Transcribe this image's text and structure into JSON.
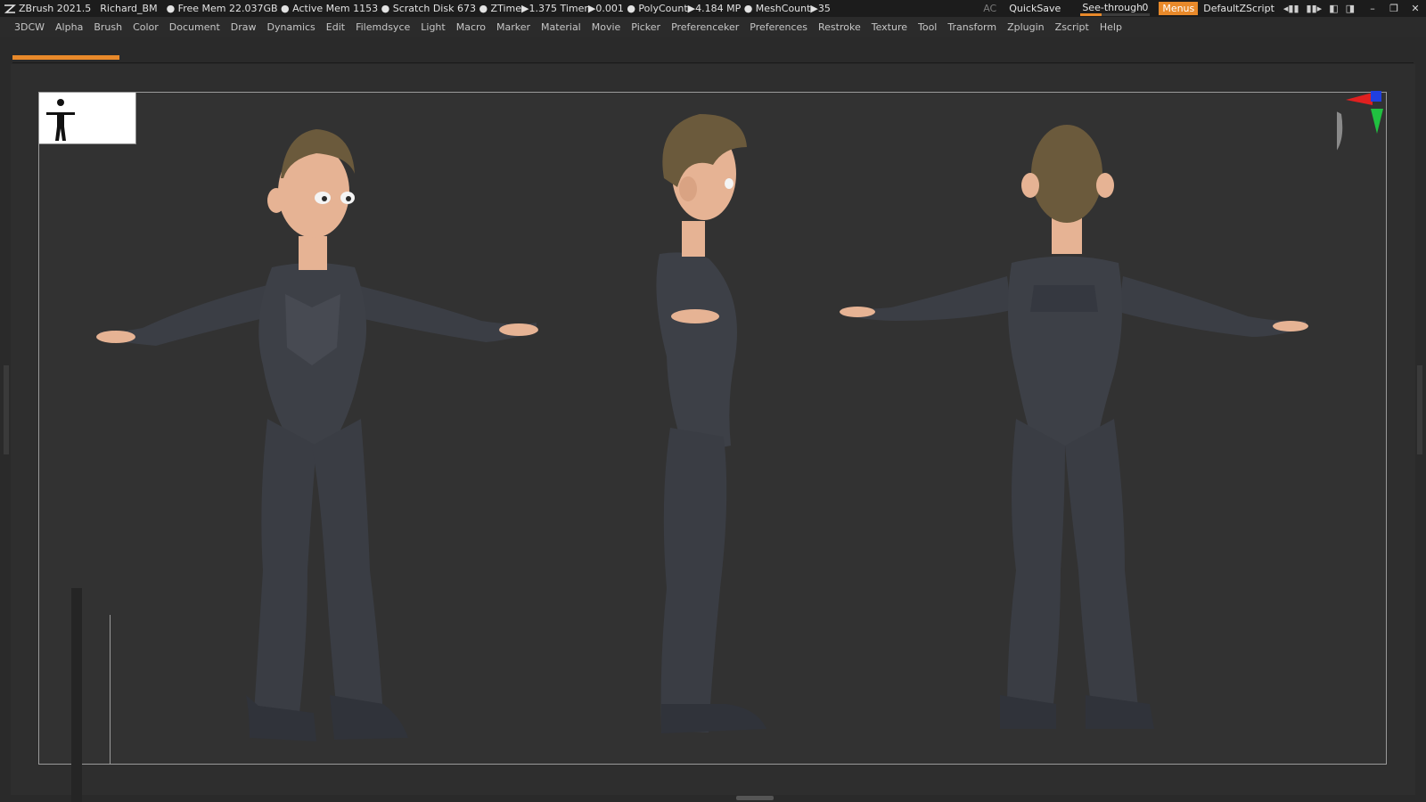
{
  "titlebar": {
    "app": "ZBrush 2021.5",
    "project": "Richard_BM",
    "stats": "● Free Mem 22.037GB ● Active Mem 1153 ● Scratch Disk 673 ● ZTime▶1.375 Timer▶0.001 ● PolyCount▶4.184 MP ● MeshCount▶35",
    "ac": "AC",
    "quicksave": "QuickSave",
    "seethrough_label": "See-through",
    "seethrough_value": "0",
    "menus": "Menus",
    "default_zscript": "DefaultZScript",
    "accent": "#e8892a"
  },
  "menubar": {
    "items": [
      "3DCW",
      "Alpha",
      "Brush",
      "Color",
      "Document",
      "Draw",
      "Dynamics",
      "Edit",
      "Filemdsyce",
      "Light",
      "Macro",
      "Marker",
      "Material",
      "Movie",
      "Picker",
      "Preferenceker",
      "Preferences",
      "Restroke",
      "Texture",
      "Tool",
      "Transform",
      "Zplugin",
      "Zscript",
      "Help"
    ]
  },
  "icons": {
    "logo": "zbrush-logo-icon",
    "thumb": "tpose-silhouette-icon",
    "gizmo": "navigation-gizmo-icon",
    "head": "head-orientation-icon"
  },
  "viewport": {
    "views": [
      "front-view",
      "side-view",
      "back-view"
    ],
    "suit_color": "#3d4047",
    "skin_color": "#e6b394",
    "hair_color": "#6b5a3c",
    "see_through_fraction": 0.3
  }
}
